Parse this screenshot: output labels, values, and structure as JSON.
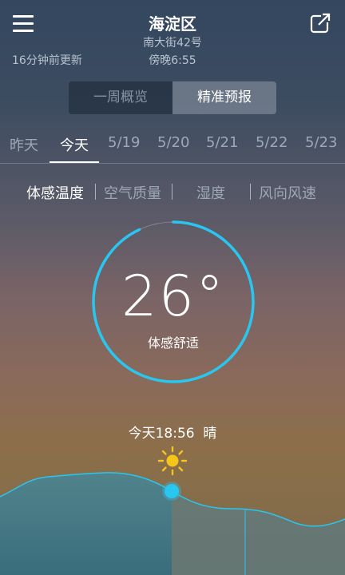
{
  "header": {
    "title": "海淀区",
    "address": "南大街42号",
    "time": "傍晚6:55",
    "updated": "16分钟前更新"
  },
  "toggle": {
    "weekly": "一周概览",
    "precise": "精准预报"
  },
  "days": [
    "昨天",
    "今天",
    "5/19",
    "5/20",
    "5/21",
    "5/22",
    "5/23"
  ],
  "metrics": [
    "体感温度",
    "空气质量",
    "湿度",
    "风向风速"
  ],
  "gauge": {
    "value": "26°",
    "label": "体感舒适",
    "fraction": 0.93
  },
  "now": {
    "time_label": "今天18:56",
    "condition": "晴"
  },
  "colors": {
    "accent": "#29c6f0",
    "sun": "#f5c518"
  },
  "icons": {
    "menu": "menu-icon",
    "share": "share-icon",
    "weather": "sun-icon"
  }
}
